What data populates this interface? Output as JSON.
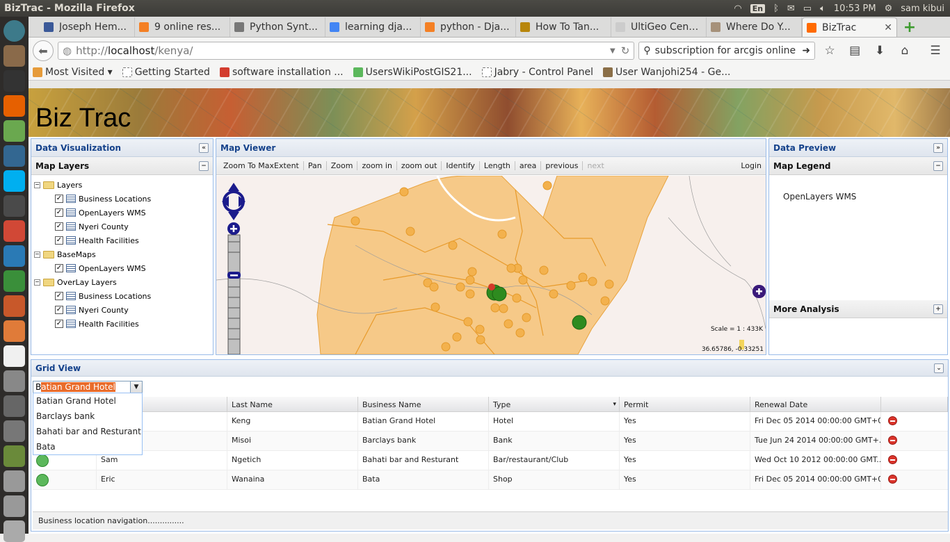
{
  "window_title": "BizTrac - Mozilla Firefox",
  "system": {
    "lang": "En",
    "clock": "10:53 PM",
    "user": "sam kibui"
  },
  "tabs": [
    {
      "label": "Joseph Hem...",
      "color": "#3b5998"
    },
    {
      "label": "9 online res...",
      "color": "#f48024"
    },
    {
      "label": "Python Synt...",
      "color": "#777777"
    },
    {
      "label": "learning dja...",
      "color": "#4285f4"
    },
    {
      "label": "python - Dja...",
      "color": "#f48024"
    },
    {
      "label": "How To Tan...",
      "color": "#b8860b"
    },
    {
      "label": "UltiGeo Center |...",
      "color": "#cccccc"
    },
    {
      "label": "Where Do Y...",
      "color": "#a6917a"
    },
    {
      "label": "BizTrac",
      "color": "#ff6a00"
    }
  ],
  "nav": {
    "url_prefix": "http://",
    "url_host": "localhost",
    "url_path": "/kenya/",
    "search": "subscription for arcgis online"
  },
  "bookmarks": [
    {
      "label": "Most Visited ▾",
      "color": "#e69b3a"
    },
    {
      "label": "Getting Started",
      "color": "#cccccc"
    },
    {
      "label": "software installation ...",
      "color": "#d33c2e"
    },
    {
      "label": "UsersWikiPostGIS21...",
      "color": "#5cb85c"
    },
    {
      "label": "Jabry - Control Panel",
      "color": "#cccccc"
    },
    {
      "label": "User Wanjohi254 - Ge...",
      "color": "#8b6f47"
    }
  ],
  "app": {
    "title": "Biz Trac",
    "left_panel": {
      "title": "Data Visualization",
      "sub_title": "Map Layers",
      "tree": [
        {
          "type": "group",
          "label": "Layers"
        },
        {
          "type": "leaf",
          "label": "Business Locations"
        },
        {
          "type": "leaf",
          "label": "OpenLayers WMS"
        },
        {
          "type": "leaf",
          "label": "Nyeri County"
        },
        {
          "type": "leaf",
          "label": "Health Facilities"
        },
        {
          "type": "group",
          "label": "BaseMaps"
        },
        {
          "type": "leaf",
          "label": "OpenLayers WMS"
        },
        {
          "type": "group",
          "label": "OverLay Layers"
        },
        {
          "type": "leaf",
          "label": "Business Locations"
        },
        {
          "type": "leaf",
          "label": "Nyeri County"
        },
        {
          "type": "leaf",
          "label": "Health Facilities"
        }
      ]
    },
    "map_panel": {
      "title": "Map Viewer",
      "tools": [
        "Zoom To MaxExtent",
        "Pan",
        "Zoom",
        "zoom in",
        "zoom out",
        "Identify",
        "Length",
        "area",
        "previous",
        "next"
      ],
      "login": "Login",
      "scale": "Scale = 1 : 433K",
      "coords": "36.65786, -0.33251"
    },
    "right_panel": {
      "title": "Data Preview",
      "legend_title": "Map Legend",
      "legend_item": "OpenLayers WMS",
      "more": "More Analysis"
    },
    "grid": {
      "title": "Grid View",
      "combo_value": "Batian Grand Hotel",
      "combo_typed": "B",
      "combo_highlight": "atian Grand Hotel",
      "dropdown": [
        "Batian Grand Hotel",
        "Barclays bank",
        "Bahati bar and Resturant",
        "Bata"
      ],
      "columns": [
        "",
        "",
        "Last Name",
        "Business Name",
        "Type",
        "Permit",
        "Renewal Date",
        ""
      ],
      "rows": [
        {
          "first": "",
          "last": "Keng",
          "business": "Batian Grand Hotel",
          "type": "Hotel",
          "permit": "Yes",
          "renewal": "Fri Dec 05 2014 00:00:00 GMT+0..."
        },
        {
          "first": "",
          "last": "Misoi",
          "business": "Barclays bank",
          "type": "Bank",
          "permit": "Yes",
          "renewal": "Tue Jun 24 2014 00:00:00 GMT+..."
        },
        {
          "first": "Sam",
          "last": "Ngetich",
          "business": "Bahati bar and Resturant",
          "type": "Bar/restaurant/Club",
          "permit": "Yes",
          "renewal": "Wed Oct 10 2012 00:00:00 GMT..."
        },
        {
          "first": "Eric",
          "last": "Wanaina",
          "business": "Bata",
          "type": "Shop",
          "permit": "Yes",
          "renewal": "Fri Dec 05 2014 00:00:00 GMT+0..."
        }
      ],
      "footer": "Business location navigation..............."
    }
  },
  "launcher": [
    {
      "icon": "dash-icon",
      "color": "#3d7a8a"
    },
    {
      "icon": "files-icon",
      "color": "#8a6a4a"
    },
    {
      "icon": "terminal-icon",
      "color": "#333333"
    },
    {
      "icon": "firefox-icon",
      "color": "#e66000"
    },
    {
      "icon": "qgis-icon",
      "color": "#6aa84f"
    },
    {
      "icon": "postgres-icon",
      "color": "#336791"
    },
    {
      "icon": "skype-icon",
      "color": "#00aff0"
    },
    {
      "icon": "sublime-icon",
      "color": "#4a4a4a"
    },
    {
      "icon": "gmail-icon",
      "color": "#d14836"
    },
    {
      "icon": "writer-icon",
      "color": "#2a7ab5"
    },
    {
      "icon": "calc-icon",
      "color": "#3a8f3a"
    },
    {
      "icon": "impress-icon",
      "color": "#c8582a"
    },
    {
      "icon": "software-center-icon",
      "color": "#e07b39"
    },
    {
      "icon": "amazon-icon",
      "color": "#f0f0f0"
    },
    {
      "icon": "settings-icon",
      "color": "#888888"
    },
    {
      "icon": "calculator-icon",
      "color": "#666666"
    },
    {
      "icon": "camera-icon",
      "color": "#777777"
    },
    {
      "icon": "installer-icon",
      "color": "#6a8a3a"
    },
    {
      "icon": "drive-icon",
      "color": "#999999"
    },
    {
      "icon": "drive-icon-2",
      "color": "#999999"
    },
    {
      "icon": "trash-icon",
      "color": "#aaaaaa"
    }
  ]
}
